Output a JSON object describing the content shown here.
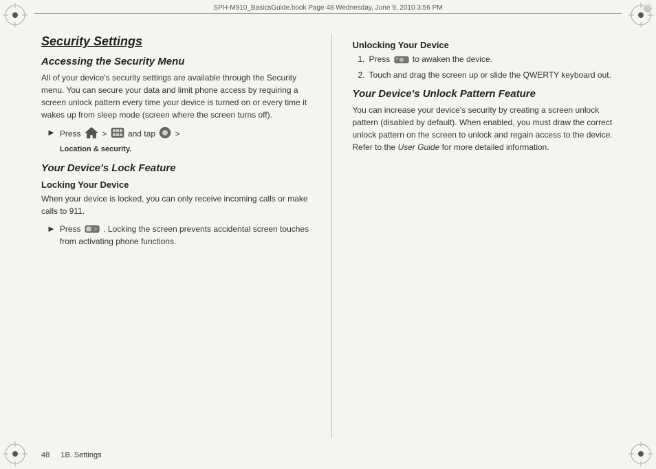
{
  "topbar": {
    "text": "SPH-M910_BasicsGuide.book  Page 48  Wednesday, June 9, 2010  3:56 PM"
  },
  "page_number": "48",
  "section_label": "1B. Settings",
  "left": {
    "main_title": "Security Settings",
    "section1_heading": "Accessing the Security Menu",
    "section1_body": "All of your device's security settings are available through the Security menu. You can secure your data and limit phone access by requiring a screen unlock pattern every time your device is turned on or every time it wakes up from sleep mode (screen where the screen turns off).",
    "bullet1_prefix": "Press",
    "bullet1_middle": " > ",
    "bullet1_middle2": " and tap ",
    "bullet1_suffix": " > ",
    "bullet1_label": "Location & security.",
    "section2_heading": "Your Device's Lock Feature",
    "subsection2_heading": "Locking Your Device",
    "section2_body": "When your device is locked, you can only receive incoming calls or make calls to 911.",
    "bullet2_prefix": "Press",
    "bullet2_suffix": ". Locking the screen prevents accidental screen touches from activating phone functions."
  },
  "right": {
    "subsection_heading": "Unlocking Your Device",
    "item1_prefix": "Press",
    "item1_suffix": " to awaken the device.",
    "item2_text": "Touch and drag the screen up or slide the QWERTY keyboard out.",
    "section_heading": "Your Device's Unlock Pattern Feature",
    "body_text": "You can increase your device's security by creating a screen unlock pattern (disabled by default). When enabled, you must draw the correct unlock pattern on the screen to unlock and regain access to the device. Refer to the ",
    "body_italic": "User Guide",
    "body_suffix": " for more detailed information."
  }
}
